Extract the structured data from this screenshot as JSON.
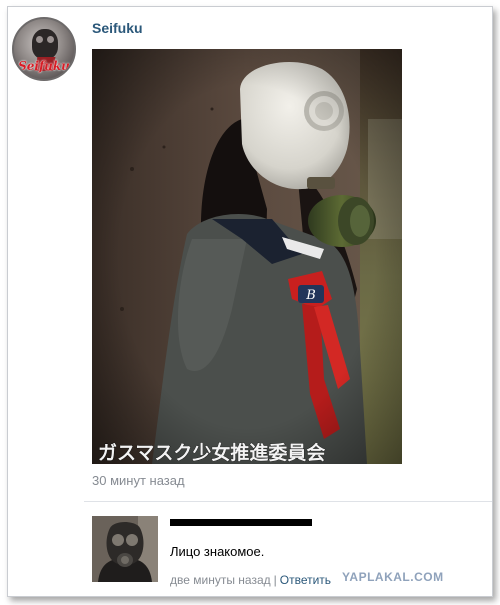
{
  "post": {
    "author": "Seifuku",
    "avatar_logo_text": "Seifuku",
    "photo": {
      "overlay_text": "ガスマスク少女推進委員会",
      "scarf_emblem": "B"
    },
    "time_ago": "30 минут назад"
  },
  "comment": {
    "text": "Лицо знакомое.",
    "time_ago": "две минуты назад",
    "separator": "|",
    "reply_label": "Ответить"
  },
  "watermark": "YAPLAKAL.COM",
  "colors": {
    "link_blue": "#2b587a",
    "muted_gray": "#868b92",
    "scarf_red": "#c8201f",
    "redaction": "#000000"
  },
  "icons": {
    "avatar": "gas-mask-girl-avatar",
    "comment_avatar": "gas-mask-man-avatar"
  }
}
